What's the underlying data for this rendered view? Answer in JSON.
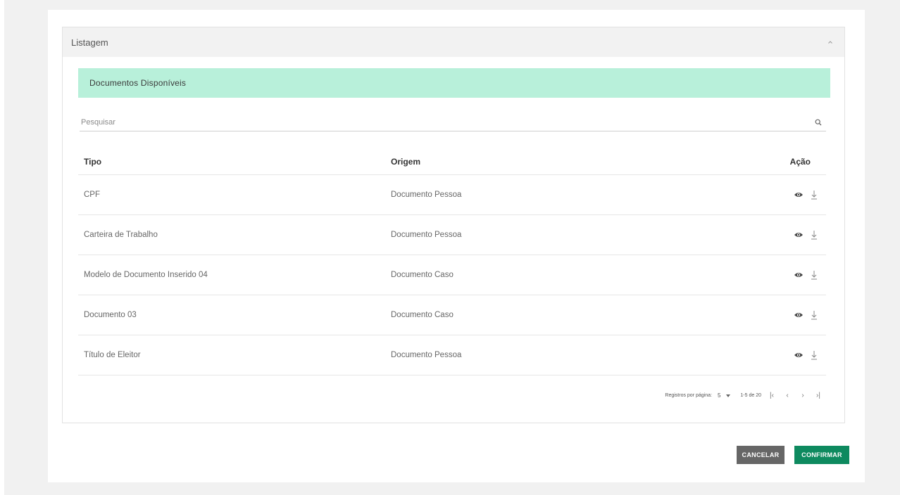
{
  "panel": {
    "title": "Listagem",
    "collapse_icon": "chevron-up-icon"
  },
  "section": {
    "title": "Documentos Disponíveis"
  },
  "search": {
    "placeholder": "Pesquisar",
    "icon": "search-icon"
  },
  "table": {
    "headers": {
      "tipo": "Tipo",
      "origem": "Origem",
      "acao": "Ação"
    },
    "rows": [
      {
        "tipo": "CPF",
        "origem": "Documento Pessoa"
      },
      {
        "tipo": "Carteira de Trabalho",
        "origem": "Documento Pessoa"
      },
      {
        "tipo": "Modelo de Documento Inserido 04",
        "origem": "Documento Caso"
      },
      {
        "tipo": "Documento 03",
        "origem": "Documento Caso"
      },
      {
        "tipo": "Título de Eleitor",
        "origem": "Documento Pessoa"
      }
    ],
    "row_action_icons": [
      "eye-icon",
      "download-icon"
    ]
  },
  "pagination": {
    "label": "Registros por página:",
    "per_page": "5",
    "range": "1-5 de 20",
    "first": "|‹",
    "prev": "‹",
    "next": "›",
    "last": "›|"
  },
  "buttons": {
    "cancel": "CANCELAR",
    "confirm": "CONFIRMAR"
  },
  "colors": {
    "section_bar": "#b8f0da",
    "confirm": "#0e8a5f",
    "cancel": "#666666",
    "page_bg": "#f1f1f1"
  }
}
